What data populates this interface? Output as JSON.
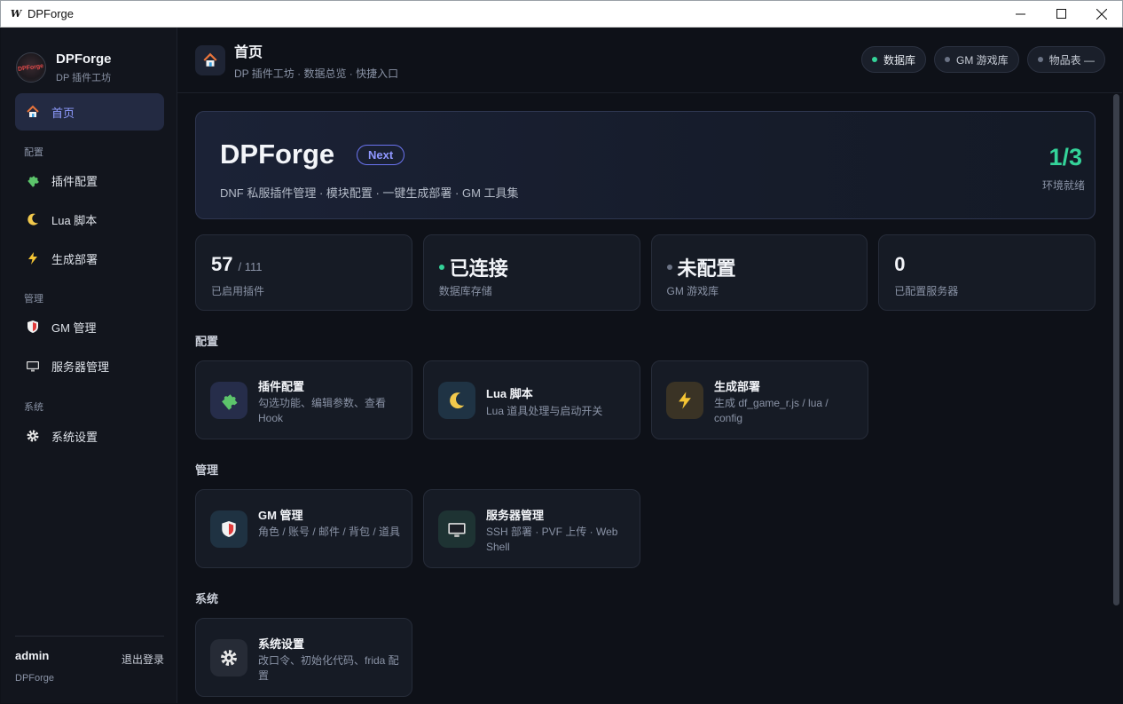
{
  "window": {
    "logo": "W",
    "title": "DPForge"
  },
  "sidebar": {
    "brand_name": "DPForge",
    "brand_sub": "DP 插件工坊",
    "avatar_text": "DPForge",
    "home_label": "首页",
    "sections": [
      {
        "title": "配置",
        "items": [
          {
            "label": "插件配置",
            "icon": "puzzle-icon"
          },
          {
            "label": "Lua 脚本",
            "icon": "moon-icon"
          },
          {
            "label": "生成部署",
            "icon": "lightning-icon"
          }
        ]
      },
      {
        "title": "管理",
        "items": [
          {
            "label": "GM 管理",
            "icon": "shield-icon"
          },
          {
            "label": "服务器管理",
            "icon": "monitor-icon"
          }
        ]
      },
      {
        "title": "系统",
        "items": [
          {
            "label": "系统设置",
            "icon": "gear-icon"
          }
        ]
      }
    ],
    "footer": {
      "user": "admin",
      "logout": "退出登录",
      "brand": "DPForge"
    }
  },
  "topbar": {
    "title": "首页",
    "subtitle": "DP 插件工坊 · 数据总览 · 快捷入口",
    "pills": [
      {
        "label": "数据库",
        "status": "ok"
      },
      {
        "label": "GM 游戏库",
        "status": "off"
      },
      {
        "label": "物品表 —",
        "status": "off"
      }
    ]
  },
  "hero": {
    "title": "DPForge",
    "tag": "Next",
    "subtitle": "DNF 私服插件管理 · 模块配置 · 一键生成部署 · GM 工具集",
    "ratio": "1/3",
    "ratio_label": "环境就绪"
  },
  "stats": [
    {
      "value": "57",
      "of": "/ 111",
      "label": "已启用插件"
    },
    {
      "value": "已连接",
      "label": "数据库存储",
      "dot": "#34d399"
    },
    {
      "value": "未配置",
      "label": "GM 游戏库",
      "dot": "#6b7385"
    },
    {
      "value": "0",
      "label": "已配置服务器"
    }
  ],
  "groups": [
    {
      "title": "配置",
      "cards": [
        {
          "title": "插件配置",
          "desc": "勾选功能、编辑参数、查看 Hook",
          "icon": "puzzle-icon"
        },
        {
          "title": "Lua 脚本",
          "desc": "Lua 道具处理与启动开关",
          "icon": "moon-icon"
        },
        {
          "title": "生成部署",
          "desc": "生成 df_game_r.js / lua / config",
          "icon": "lightning-icon"
        }
      ]
    },
    {
      "title": "管理",
      "cards": [
        {
          "title": "GM 管理",
          "desc": "角色 / 账号 / 邮件 / 背包 / 道具",
          "icon": "shield-icon"
        },
        {
          "title": "服务器管理",
          "desc": "SSH 部署 · PVF 上传 · Web Shell",
          "icon": "monitor-icon"
        }
      ]
    },
    {
      "title": "系统",
      "cards": [
        {
          "title": "系统设置",
          "desc": "改口令、初始化代码、frida 配置",
          "icon": "gear-icon"
        }
      ]
    }
  ],
  "colors": {
    "accent": "#8f9cff",
    "success": "#34d399",
    "background": "#0e1118"
  }
}
